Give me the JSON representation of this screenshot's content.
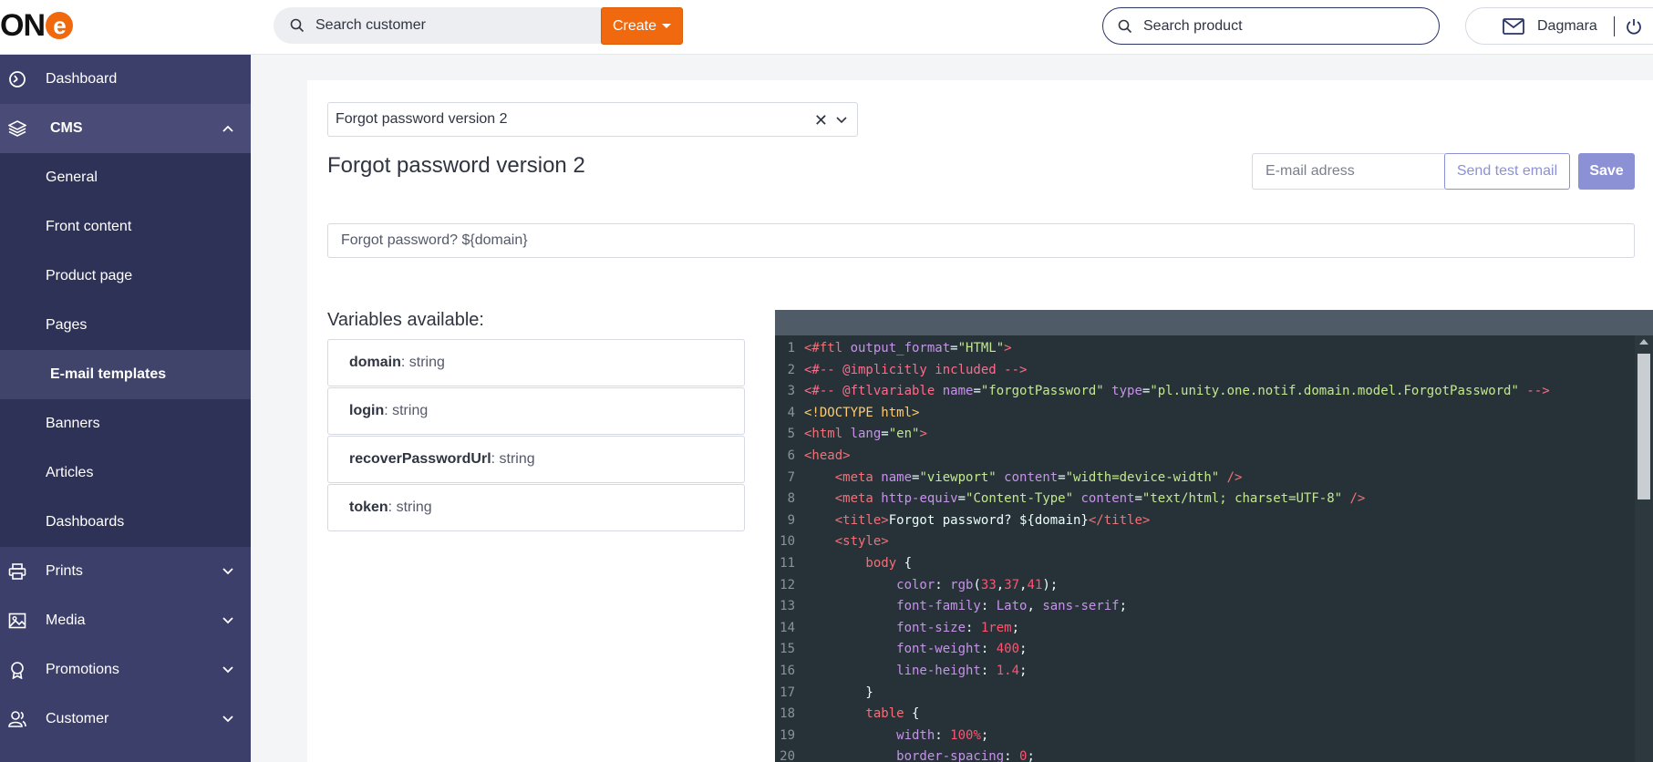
{
  "topbar": {
    "logo_text": "ON",
    "logo_e": "e",
    "search_customer_placeholder": "Search customer",
    "create_label": "Create",
    "search_product_placeholder": "Search product",
    "user_name": "Dagmara"
  },
  "sidebar": {
    "items": [
      {
        "label": "Dashboard",
        "icon": "dashboard-icon"
      },
      {
        "label": "CMS",
        "icon": "layers-icon",
        "expanded": true
      },
      {
        "label": "Prints",
        "icon": "printer-icon"
      },
      {
        "label": "Media",
        "icon": "image-icon"
      },
      {
        "label": "Promotions",
        "icon": "award-icon"
      },
      {
        "label": "Customer",
        "icon": "users-icon"
      }
    ],
    "cms_sub": [
      {
        "label": "General"
      },
      {
        "label": "Front content"
      },
      {
        "label": "Product page"
      },
      {
        "label": "Pages"
      },
      {
        "label": "E-mail templates",
        "active": true
      },
      {
        "label": "Banners"
      },
      {
        "label": "Articles"
      },
      {
        "label": "Dashboards"
      }
    ]
  },
  "main": {
    "template_select_value": "Forgot password version 2",
    "title": "Forgot password version 2",
    "email_placeholder": "E-mail adress",
    "send_test_label": "Send test email",
    "save_label": "Save",
    "subject_value": "Forgot password? ${domain}",
    "variables_title": "Variables available:",
    "variables": [
      {
        "name": "domain",
        "type": ": string"
      },
      {
        "name": "login",
        "type": ": string"
      },
      {
        "name": "recoverPasswordUrl",
        "type": ": string"
      },
      {
        "name": "token",
        "type": ": string"
      }
    ]
  },
  "editor": {
    "lines": [
      [
        [
          "<#ftl ",
          "t"
        ],
        [
          "output_format",
          "a"
        ],
        [
          "=",
          "p"
        ],
        [
          "\"HTML\"",
          "s"
        ],
        [
          ">",
          "t"
        ]
      ],
      [
        [
          "<#-- @implicitly included -->",
          "c"
        ]
      ],
      [
        [
          "<#-- @ftlvariable ",
          "c"
        ],
        [
          "name",
          "a"
        ],
        [
          "=",
          "p"
        ],
        [
          "\"forgotPassword\"",
          "s"
        ],
        [
          " type",
          "a"
        ],
        [
          "=",
          "p"
        ],
        [
          "\"pl.unity.one.notif.domain.model.ForgotPassword\"",
          "s"
        ],
        [
          " -->",
          "c"
        ]
      ],
      [
        [
          "<!DOCTYPE html>",
          "y"
        ]
      ],
      [
        [
          "<html ",
          "t"
        ],
        [
          "lang",
          "a"
        ],
        [
          "=",
          "p"
        ],
        [
          "\"en\"",
          "s"
        ],
        [
          ">",
          "t"
        ]
      ],
      [
        [
          "<head>",
          "t"
        ]
      ],
      [
        [
          "    <meta ",
          "t"
        ],
        [
          "name",
          "a"
        ],
        [
          "=",
          "p"
        ],
        [
          "\"viewport\"",
          "s"
        ],
        [
          " content",
          "a"
        ],
        [
          "=",
          "p"
        ],
        [
          "\"width=device-width\"",
          "s"
        ],
        [
          " />",
          "t"
        ]
      ],
      [
        [
          "    <meta ",
          "t"
        ],
        [
          "http-equiv",
          "a"
        ],
        [
          "=",
          "p"
        ],
        [
          "\"Content-Type\"",
          "s"
        ],
        [
          " content",
          "a"
        ],
        [
          "=",
          "p"
        ],
        [
          "\"text/html; charset=UTF-8\"",
          "s"
        ],
        [
          " />",
          "t"
        ]
      ],
      [
        [
          "    <title>",
          "t"
        ],
        [
          "Forgot password? ${domain}",
          "p"
        ],
        [
          "</title>",
          "t"
        ]
      ],
      [
        [
          "    <style>",
          "t"
        ]
      ],
      [
        [
          "        body",
          "t"
        ],
        [
          " {",
          "p"
        ]
      ],
      [
        [
          "            color",
          "a"
        ],
        [
          ": ",
          "p"
        ],
        [
          "rgb",
          "a"
        ],
        [
          "(",
          "p"
        ],
        [
          "33",
          "n"
        ],
        [
          ",",
          "p"
        ],
        [
          "37",
          "n"
        ],
        [
          ",",
          "p"
        ],
        [
          "41",
          "n"
        ],
        [
          ");",
          "p"
        ]
      ],
      [
        [
          "            font-family",
          "a"
        ],
        [
          ": ",
          "p"
        ],
        [
          "Lato",
          "a"
        ],
        [
          ", ",
          "p"
        ],
        [
          "sans-serif",
          "a"
        ],
        [
          ";",
          "p"
        ]
      ],
      [
        [
          "            font-size",
          "a"
        ],
        [
          ": ",
          "p"
        ],
        [
          "1rem",
          "n"
        ],
        [
          ";",
          "p"
        ]
      ],
      [
        [
          "            font-weight",
          "a"
        ],
        [
          ": ",
          "p"
        ],
        [
          "400",
          "n"
        ],
        [
          ";",
          "p"
        ]
      ],
      [
        [
          "            line-height",
          "a"
        ],
        [
          ": ",
          "p"
        ],
        [
          "1.4",
          "n"
        ],
        [
          ";",
          "p"
        ]
      ],
      [
        [
          "        }",
          "p"
        ]
      ],
      [
        [
          "        table",
          "t"
        ],
        [
          " {",
          "p"
        ]
      ],
      [
        [
          "            width",
          "a"
        ],
        [
          ": ",
          "p"
        ],
        [
          "100%",
          "n"
        ],
        [
          ";",
          "p"
        ]
      ],
      [
        [
          "            border-spacing",
          "a"
        ],
        [
          ": ",
          "p"
        ],
        [
          "0",
          "n"
        ],
        [
          ";",
          "p"
        ]
      ]
    ]
  }
}
